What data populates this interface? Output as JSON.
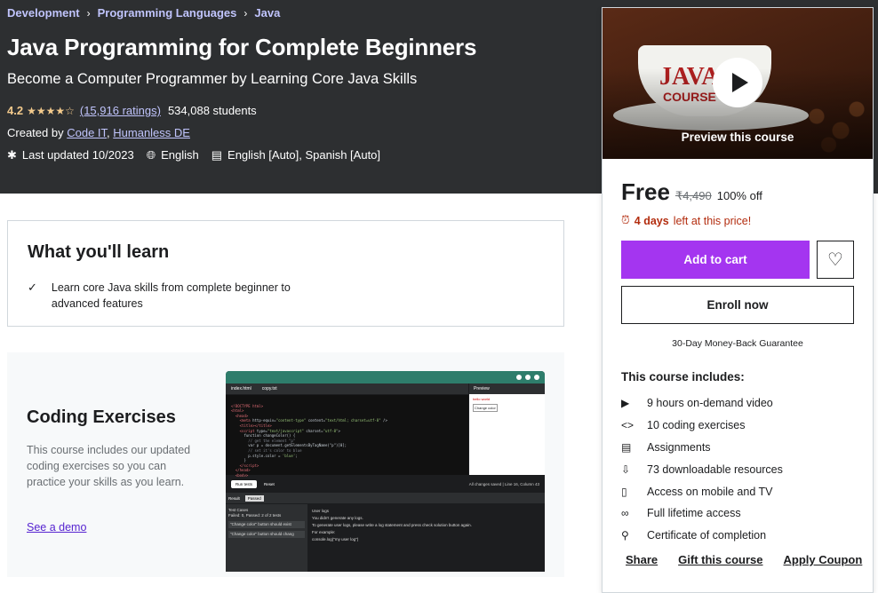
{
  "breadcrumb": [
    "Development",
    "Programming Languages",
    "Java"
  ],
  "course": {
    "title": "Java Programming for Complete Beginners",
    "subtitle": "Become a Computer Programmer by Learning Core Java Skills",
    "rating": "4.2",
    "stars_filled": 4.2,
    "ratings_count": "(15,916 ratings)",
    "students": "534,088 students",
    "created_by_label": "Created by",
    "authors": [
      "Code IT",
      "Humanless DE"
    ],
    "last_updated": "Last updated 10/2023",
    "language": "English",
    "captions": "English [Auto], Spanish [Auto]"
  },
  "learn": {
    "title": "What you'll learn",
    "items": [
      "Learn core Java skills from complete beginner to advanced features"
    ]
  },
  "coding": {
    "title": "Coding Exercises",
    "description": "This course includes our updated coding exercises so you can practice your skills as you learn.",
    "demo_link": "See a demo",
    "ide": {
      "tabs": [
        "index.html",
        "copy.txt"
      ],
      "preview_label": "Preview",
      "preview_text": "hello world",
      "preview_button": "Change color",
      "run_label": "Run tests",
      "reset_label": "Reset",
      "status": "All changes saved  |  Line 16, Column 43",
      "result_tab": "Result",
      "passed_tab": "Passed",
      "test_cases_title": "Test Cases",
      "test_cases_summary": "Failed: 0, Passed: 2 of 2 tests",
      "test_cases": [
        "\"Change color\" button should exist",
        "\"Change color\" button should chang"
      ],
      "logs_title": "User logs",
      "logs": [
        "You didn't generate any logs.",
        "To generate user logs, please write a log statement and press check solution button again.",
        "For example:",
        "console.log(\"my user log\")"
      ]
    }
  },
  "sidebar": {
    "preview_label": "Preview this course",
    "price": "Free",
    "original_price": "₹4,490",
    "discount": "100% off",
    "timer_bold": "4 days",
    "timer_rest": "left at this price!",
    "add_to_cart": "Add to cart",
    "enroll": "Enroll now",
    "guarantee": "30-Day Money-Back Guarantee",
    "includes_title": "This course includes:",
    "includes": [
      {
        "icon": "video-icon",
        "label": "9 hours on-demand video"
      },
      {
        "icon": "code-icon",
        "label": "10 coding exercises"
      },
      {
        "icon": "assignment-icon",
        "label": "Assignments"
      },
      {
        "icon": "download-icon",
        "label": "73 downloadable resources"
      },
      {
        "icon": "mobile-icon",
        "label": "Access on mobile and TV"
      },
      {
        "icon": "infinity-icon",
        "label": "Full lifetime access"
      },
      {
        "icon": "trophy-icon",
        "label": "Certificate of completion"
      }
    ],
    "links": [
      "Share",
      "Gift this course",
      "Apply Coupon"
    ]
  },
  "colors": {
    "hero_bg": "#2d2f31",
    "link_purple": "#c0c4fc",
    "star": "#f3ca8c",
    "cart": "#a435f0",
    "timer": "#b32d0f"
  }
}
